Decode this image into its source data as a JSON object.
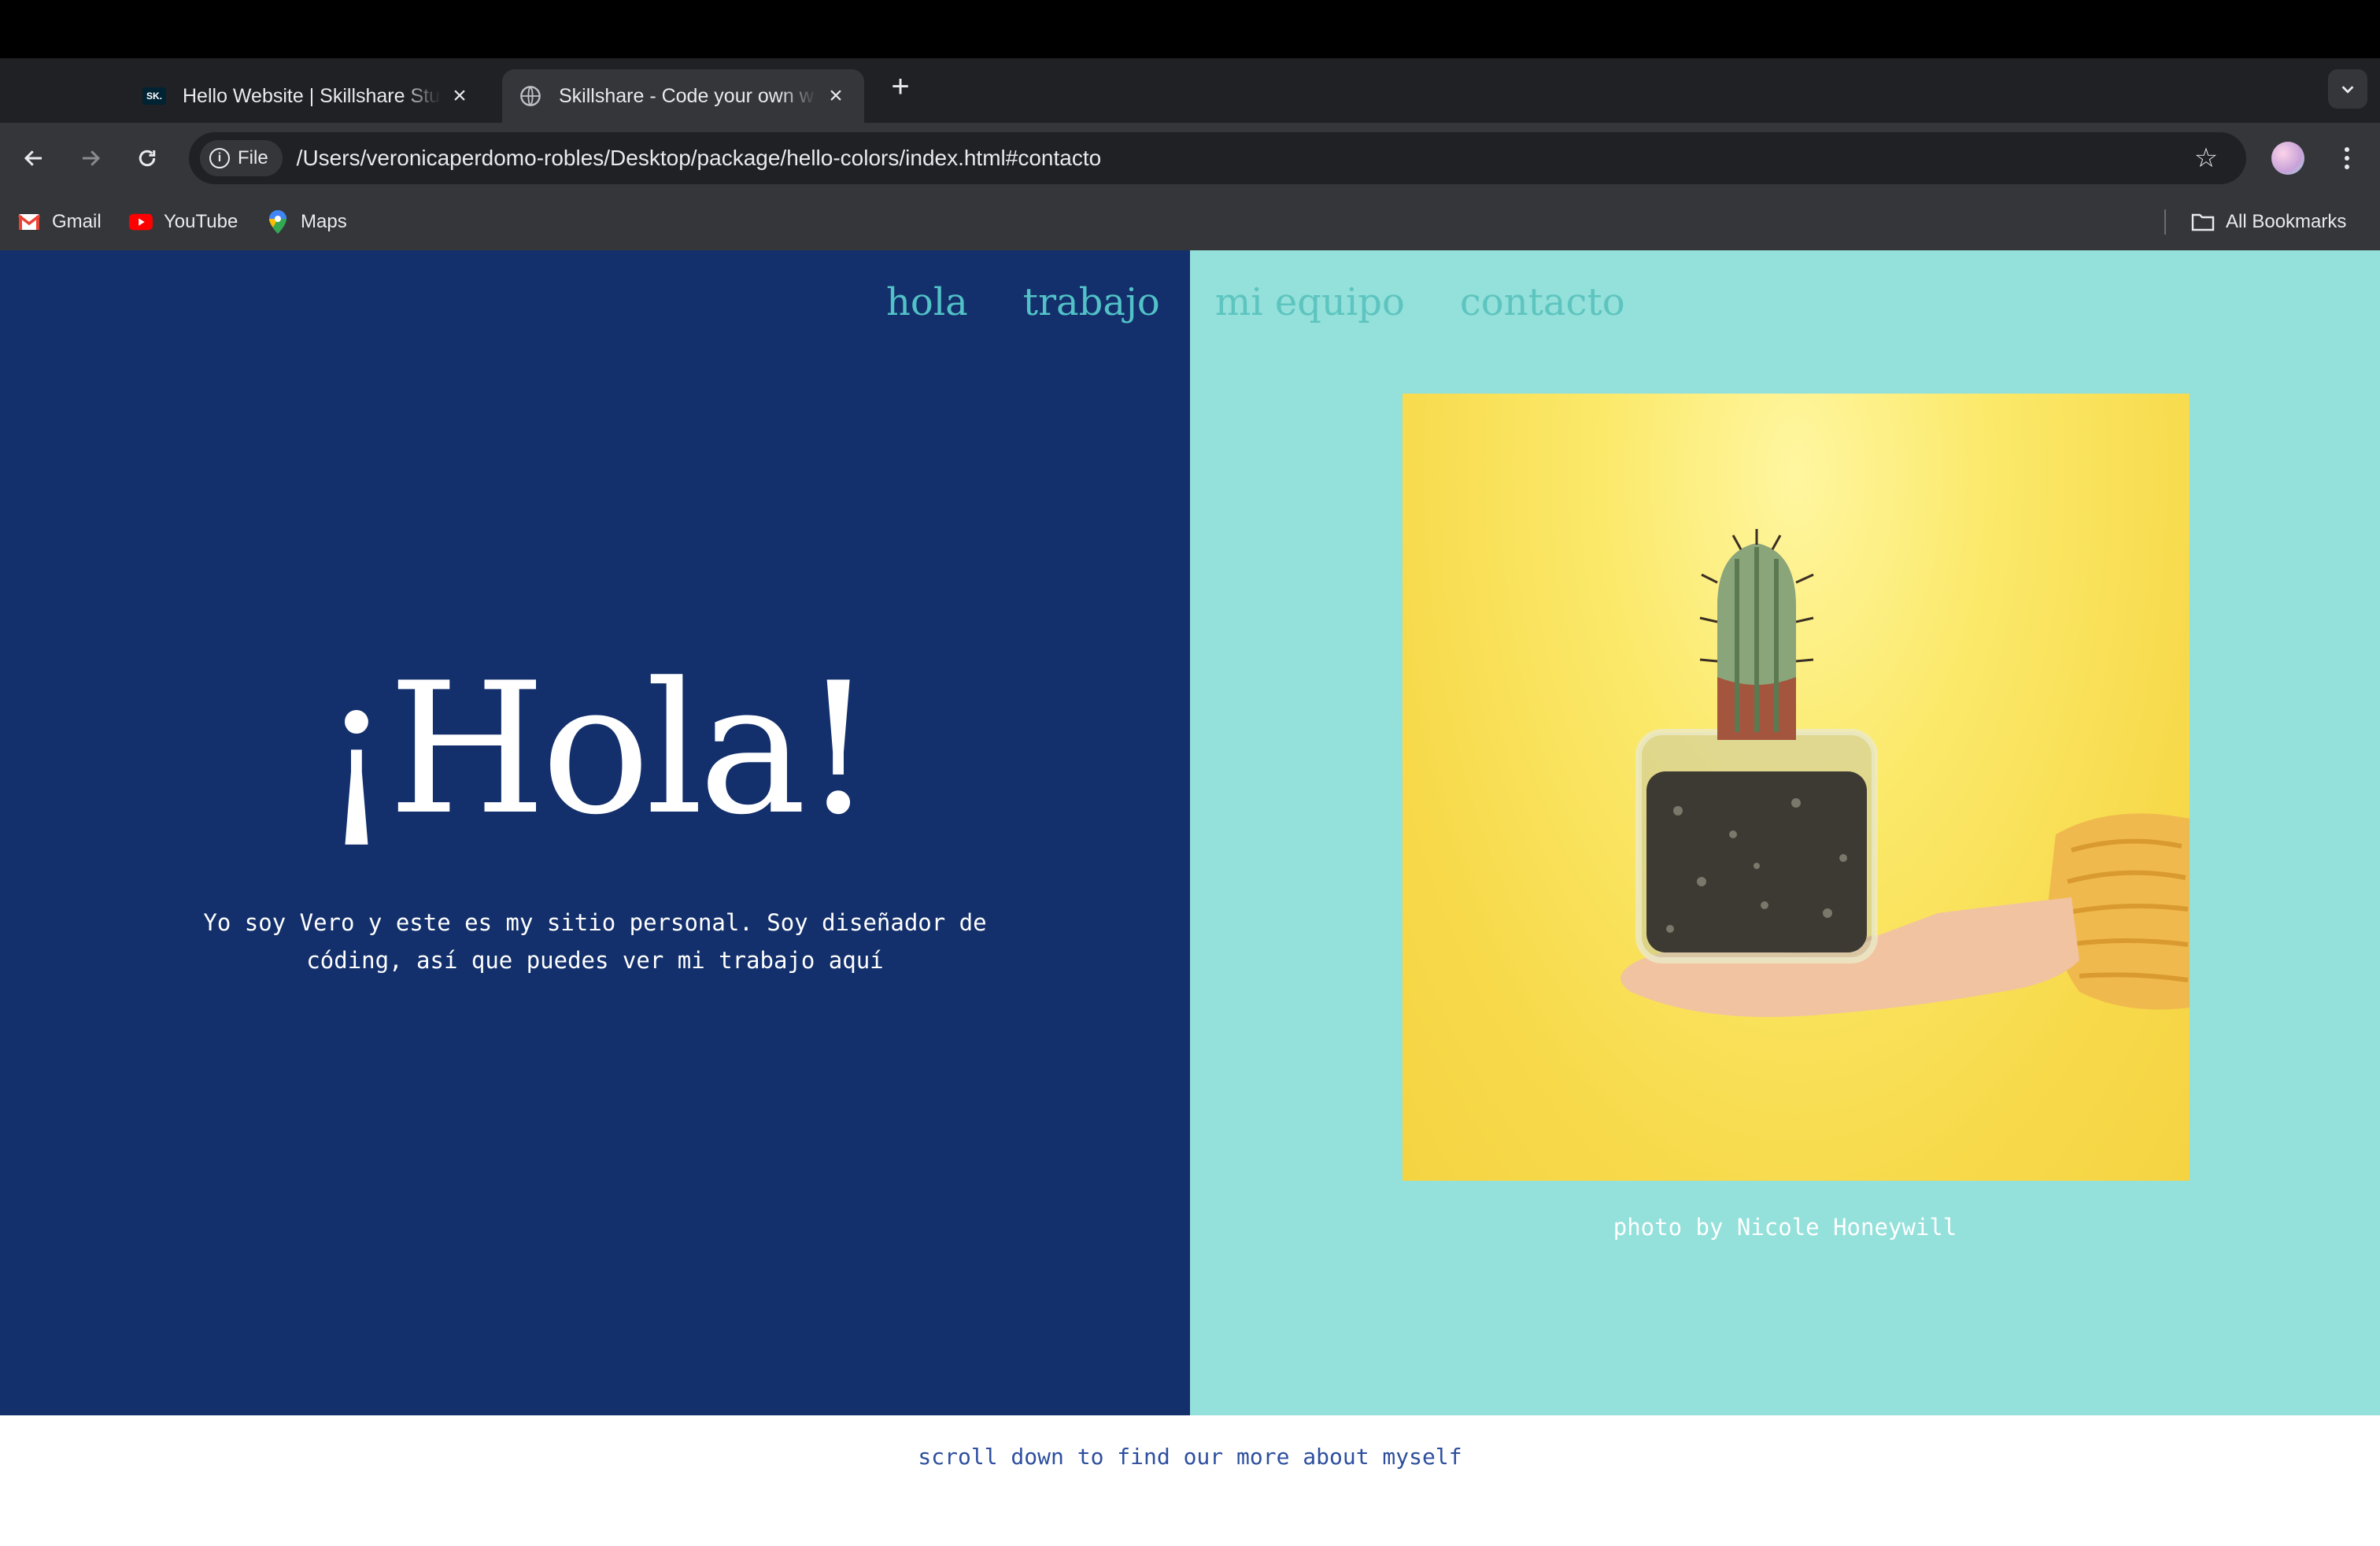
{
  "browser": {
    "tabs": [
      {
        "title": "Hello Website | Skillshare Stu",
        "active": false
      },
      {
        "title": "Skillshare - Code your own w",
        "active": true
      }
    ],
    "address": {
      "scheme_label": "File",
      "url": "/Users/veronicaperdomo-robles/Desktop/package/hello-colors/index.html#contacto"
    },
    "bookmarks": [
      {
        "label": "Gmail",
        "icon": "gmail-icon"
      },
      {
        "label": "YouTube",
        "icon": "youtube-icon"
      },
      {
        "label": "Maps",
        "icon": "maps-icon"
      }
    ],
    "all_bookmarks_label": "All Bookmarks"
  },
  "page": {
    "nav": [
      "hola",
      "trabajo",
      "mi equipo",
      "contacto"
    ],
    "hero_title": "¡Hola!",
    "hero_text": "Yo soy Vero y este es my sitio personal. Soy diseñador de códing, así que puedes ver mi trabajo aquí",
    "photo_caption": "photo by Nicole Honeywill",
    "footer_text": "scroll down to find our more about myself",
    "colors": {
      "left_bg": "#13306c",
      "right_bg": "#94e0da",
      "nav_link": "#52c2c7",
      "footer_text": "#2d4f9e"
    }
  }
}
